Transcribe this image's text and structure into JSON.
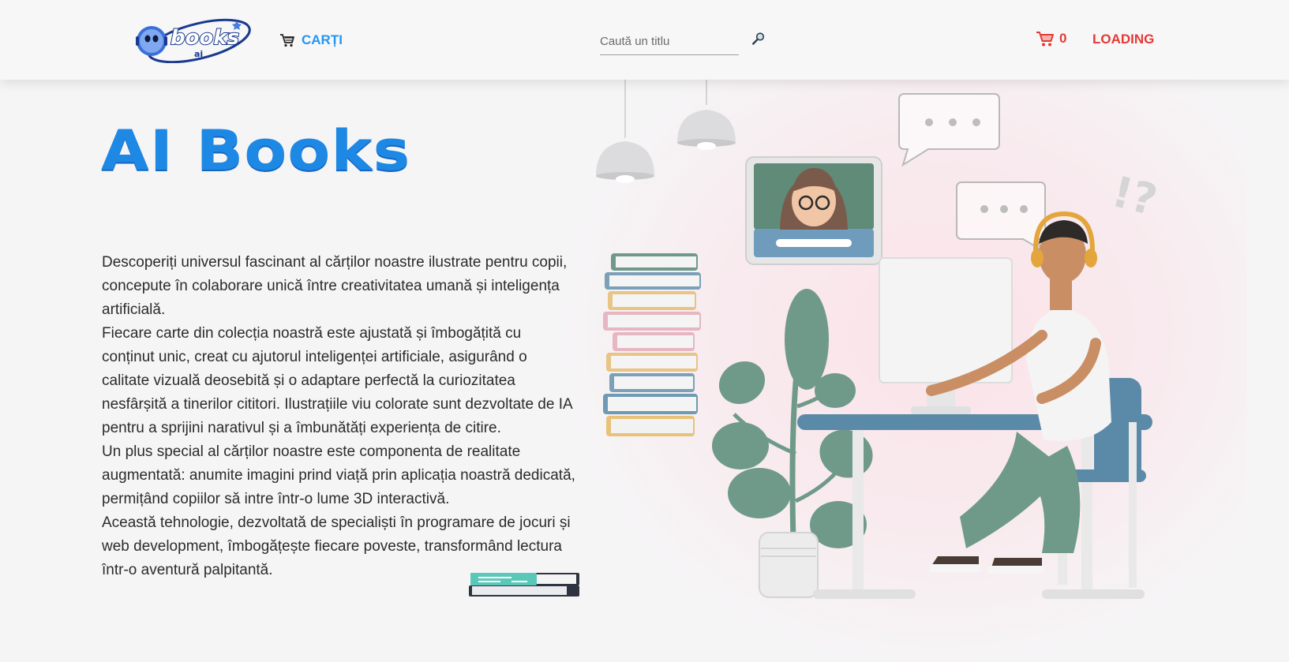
{
  "header": {
    "logo_text": "books",
    "logo_sub": "ai",
    "nav_carti_label": "CARȚI",
    "search_placeholder": "Caută un titlu",
    "cart_count": "0",
    "loading_label": "LOADING"
  },
  "hero": {
    "title": "AI Books",
    "paragraphs": [
      "Descoperiți universul fascinant al cărților noastre ilustrate pentru copii, concepute în colaborare unică între creativitatea umană și inteligența artificială.",
      "Fiecare carte din colecția noastră este ajustată și îmbogățită cu conținut unic, creat cu ajutorul inteligenței artificiale, asigurând o calitate vizuală deosebită și o adaptare perfectă la curiozitatea nesfârșită a tinerilor cititori. Ilustrațiile viu colorate sunt dezvoltate de IA pentru a sprijini narativul și a îmbunătăți experiența de citire.",
      "Un plus special al cărților noastre este componenta de realitate augmentată: anumite imagini prind viață prin aplicația noastră dedicată, permițând copiilor să intre într-o lume 3D interactivă.",
      "Această tehnologie, dezvoltată de specialiști în programare de jocuri și web development, îmbogățește fiecare poveste, transformând lectura într-o aventură palpitantă."
    ]
  },
  "icons": {
    "nav_icon": "cart-icon",
    "search_icon": "search-icon",
    "cart_icon": "cart-icon"
  },
  "colors": {
    "primary_blue": "#2196f3",
    "title_blue": "#1e88e5",
    "accent_red": "#e53935",
    "background": "#f6f5f6"
  }
}
